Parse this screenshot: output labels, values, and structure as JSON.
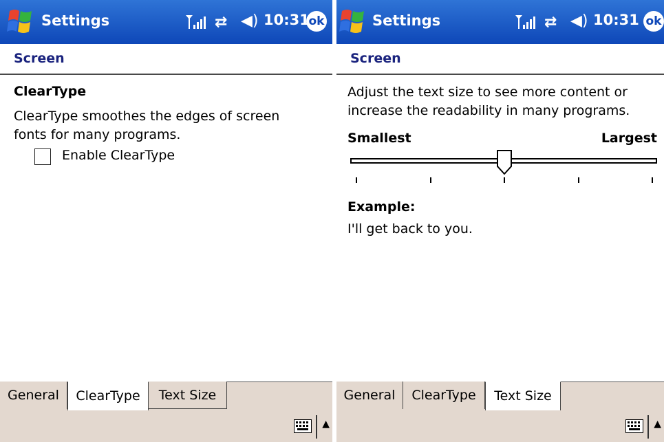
{
  "colors": {
    "titlebar_top": "#2f74d6",
    "titlebar_bottom": "#0e47b8",
    "heading": "#1a237e",
    "tabbar_bg": "#e3d8cf"
  },
  "statusbar": {
    "app_title": "Settings",
    "time": "10:31",
    "ok_label": "ok",
    "icons": [
      "windows-start-icon",
      "signal-icon",
      "sync-icon",
      "volume-icon",
      "ok-icon"
    ]
  },
  "left": {
    "section_heading": "Screen",
    "feature_title": "ClearType",
    "description": "ClearType smoothes the edges of screen fonts for many programs.",
    "checkbox_label": "Enable ClearType",
    "checkbox_checked": false,
    "tabs": [
      {
        "label": "General",
        "active": false
      },
      {
        "label": "ClearType",
        "active": true
      },
      {
        "label": "Text Size",
        "active": false
      }
    ]
  },
  "right": {
    "section_heading": "Screen",
    "description_line1": "Adjust the text size to see more content or",
    "description_line2": "increase the readability in many programs.",
    "slider": {
      "min_label": "Smallest",
      "max_label": "Largest",
      "tick_count": 5,
      "value_index": 2
    },
    "example_label": "Example:",
    "example_text": "I'll get back to you.",
    "tabs": [
      {
        "label": "General",
        "active": false
      },
      {
        "label": "ClearType",
        "active": false
      },
      {
        "label": "Text Size",
        "active": true
      }
    ]
  }
}
